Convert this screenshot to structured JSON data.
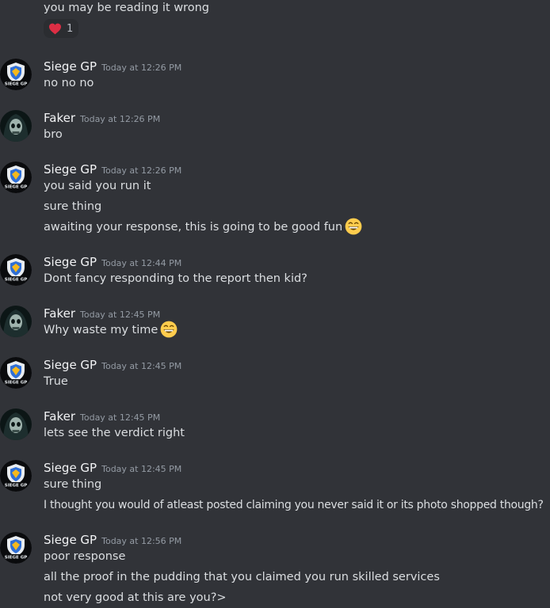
{
  "previous": {
    "text": "you may be reading it wrong",
    "reaction": {
      "icon": "red-heart-icon",
      "count": "1"
    }
  },
  "authors": {
    "siege": {
      "name": "Siege GP",
      "avatar": "siege-gp-shield-avatar"
    },
    "faker": {
      "name": "Faker",
      "avatar": "hooded-skull-avatar"
    }
  },
  "messages": [
    {
      "author": "Siege GP",
      "time": "Today at 12:26 PM",
      "lines": [
        "no no no"
      ]
    },
    {
      "author": "Faker",
      "time": "Today at 12:26 PM",
      "lines": [
        "bro"
      ]
    },
    {
      "author": "Siege GP",
      "time": "Today at 12:26 PM",
      "lines": [
        "you said you run it",
        "sure thing",
        "awaiting your response, this is going to be good fun"
      ]
    },
    {
      "author": "Siege GP",
      "time": "Today at 12:44 PM",
      "lines": [
        "Dont fancy responding to the report then kid?"
      ]
    },
    {
      "author": "Faker",
      "time": "Today at 12:45 PM",
      "lines": [
        "Why waste my time"
      ]
    },
    {
      "author": "Siege GP",
      "time": "Today at 12:45 PM",
      "lines": [
        "True"
      ]
    },
    {
      "author": "Faker",
      "time": "Today at 12:45 PM",
      "lines": [
        "lets see the verdict right"
      ]
    },
    {
      "author": "Siege GP",
      "time": "Today at 12:45 PM",
      "lines": [
        "sure thing",
        "I thought you would of atleast posted claiming you never said it or its photo shopped though?"
      ]
    },
    {
      "author": "Siege GP",
      "time": "Today at 12:56 PM",
      "lines": [
        "poor response",
        "all the proof in the pudding that you claimed you run skilled services",
        "not very good at this are you?>"
      ]
    }
  ],
  "emojis": {
    "grin": "grinning-face-emoji"
  },
  "colors": {
    "background": "#313338",
    "text": "#dbdee1",
    "author": "#f2f3f5",
    "timestamp": "#949ba4",
    "heart": "#dd2e44",
    "emoji": "#ffcc4d"
  }
}
